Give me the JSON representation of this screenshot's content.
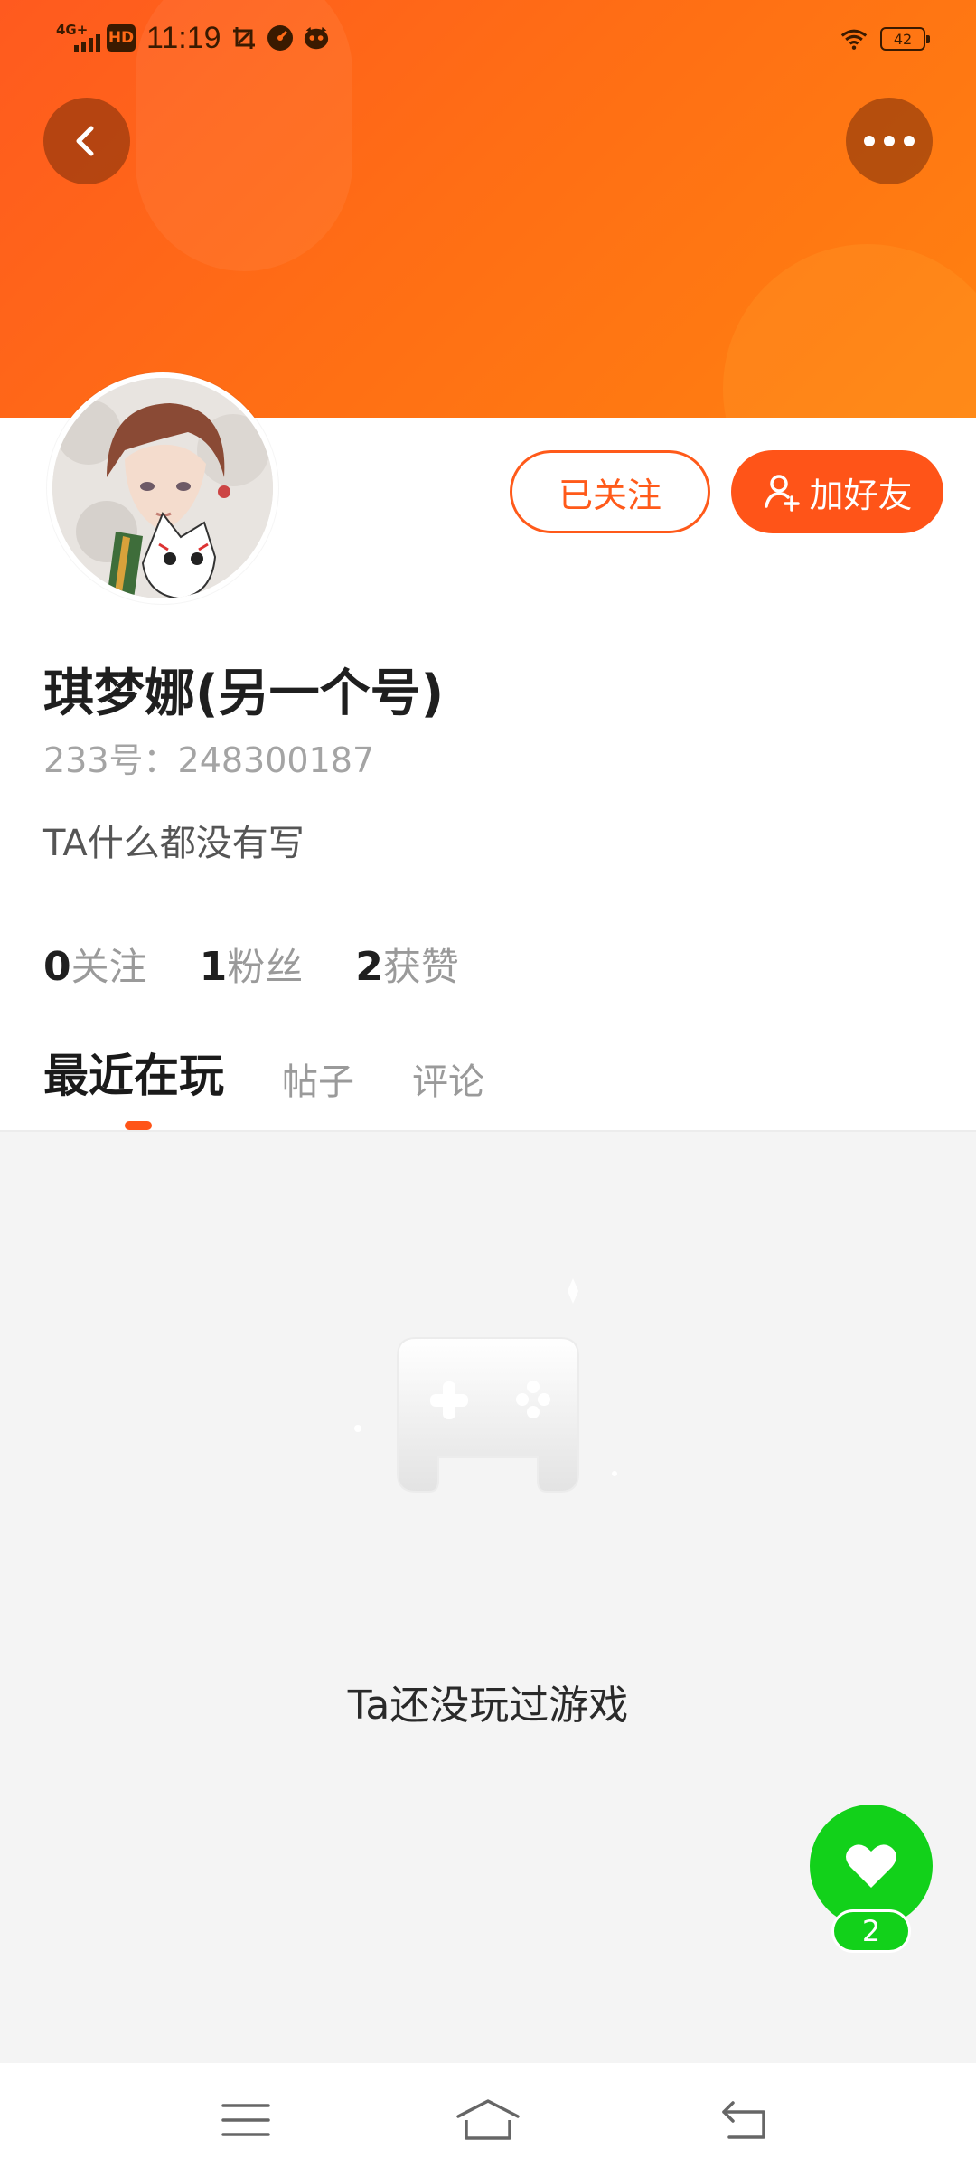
{
  "status_bar": {
    "network": "4G+",
    "hd_label": "HD",
    "time": "11:19",
    "battery": "42"
  },
  "profile": {
    "username": "琪梦娜(另一个号)",
    "id_text": "233号：248300187",
    "bio": "TA什么都没有写"
  },
  "actions": {
    "follow_label": "已关注",
    "add_friend_label": "加好友"
  },
  "stats": [
    {
      "value": "0",
      "label": "关注"
    },
    {
      "value": "1",
      "label": "粉丝"
    },
    {
      "value": "2",
      "label": "获赞"
    }
  ],
  "tabs": [
    {
      "label": "最近在玩",
      "active": true
    },
    {
      "label": "帖子",
      "active": false
    },
    {
      "label": "评论",
      "active": false
    }
  ],
  "empty_state": {
    "text": "Ta还没玩过游戏"
  },
  "like": {
    "count": "2"
  },
  "colors": {
    "accent": "#ff5418",
    "banner_start": "#ff5a1f",
    "banner_end": "#ff8210",
    "like_green": "#12d11a"
  },
  "icons": {
    "back": "chevron-left-icon",
    "more": "more-dots-icon",
    "add_friend": "user-plus-icon",
    "like": "heart-icon",
    "empty": "gamepad-icon",
    "nav_menu": "menu-icon",
    "nav_home": "home-icon",
    "nav_back": "return-icon"
  }
}
